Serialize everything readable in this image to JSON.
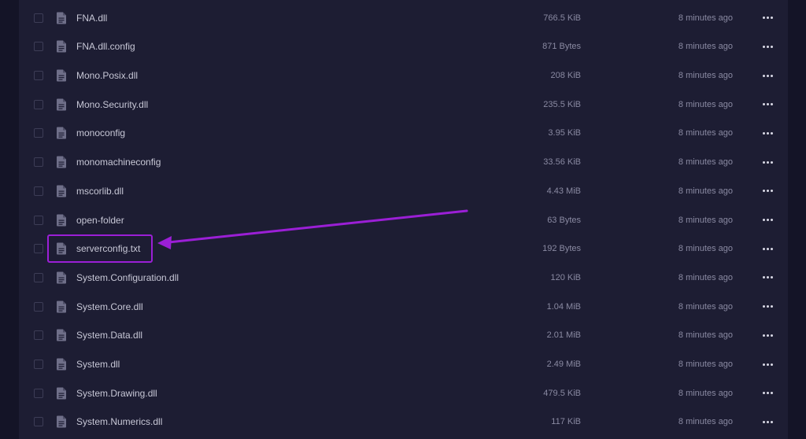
{
  "files": [
    {
      "name": "FNA.dll",
      "size": "766.5 KiB",
      "modified": "8 minutes ago"
    },
    {
      "name": "FNA.dll.config",
      "size": "871 Bytes",
      "modified": "8 minutes ago"
    },
    {
      "name": "Mono.Posix.dll",
      "size": "208 KiB",
      "modified": "8 minutes ago"
    },
    {
      "name": "Mono.Security.dll",
      "size": "235.5 KiB",
      "modified": "8 minutes ago"
    },
    {
      "name": "monoconfig",
      "size": "3.95 KiB",
      "modified": "8 minutes ago"
    },
    {
      "name": "monomachineconfig",
      "size": "33.56 KiB",
      "modified": "8 minutes ago"
    },
    {
      "name": "mscorlib.dll",
      "size": "4.43 MiB",
      "modified": "8 minutes ago"
    },
    {
      "name": "open-folder",
      "size": "63 Bytes",
      "modified": "8 minutes ago"
    },
    {
      "name": "serverconfig.txt",
      "size": "192 Bytes",
      "modified": "8 minutes ago"
    },
    {
      "name": "System.Configuration.dll",
      "size": "120 KiB",
      "modified": "8 minutes ago"
    },
    {
      "name": "System.Core.dll",
      "size": "1.04 MiB",
      "modified": "8 minutes ago"
    },
    {
      "name": "System.Data.dll",
      "size": "2.01 MiB",
      "modified": "8 minutes ago"
    },
    {
      "name": "System.dll",
      "size": "2.49 MiB",
      "modified": "8 minutes ago"
    },
    {
      "name": "System.Drawing.dll",
      "size": "479.5 KiB",
      "modified": "8 minutes ago"
    },
    {
      "name": "System.Numerics.dll",
      "size": "117 KiB",
      "modified": "8 minutes ago"
    }
  ],
  "icons": {
    "file": "file-icon",
    "more": "more-options-icon",
    "checkbox": "checkbox"
  },
  "annotation": {
    "highlighted_file": "serverconfig.txt",
    "color": "#9b1fd6"
  },
  "colors": {
    "background": "#141427",
    "panel": "#1d1d33",
    "text": "#c7c7d6",
    "muted": "#8a8aa2"
  }
}
